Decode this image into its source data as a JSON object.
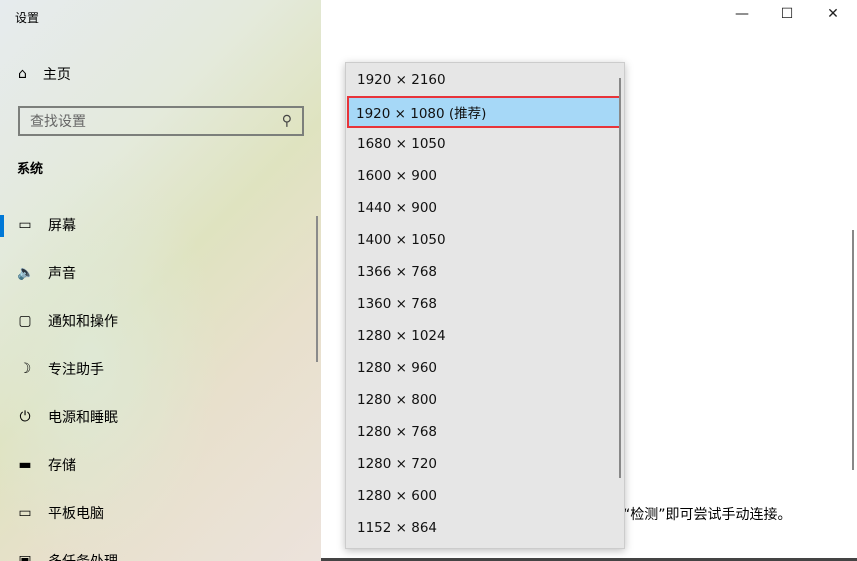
{
  "window": {
    "title": "设置",
    "minimize": "—",
    "maximize": "☐",
    "close": "✕"
  },
  "sidebar": {
    "home_label": "主页",
    "search_placeholder": "查找设置",
    "section": "系统",
    "items": [
      {
        "label": "屏幕",
        "icon": "▭"
      },
      {
        "label": "声音",
        "icon": "🔈"
      },
      {
        "label": "通知和操作",
        "icon": "▢"
      },
      {
        "label": "专注助手",
        "icon": "☽"
      },
      {
        "label": "电源和睡眠",
        "icon": "⏻"
      },
      {
        "label": "存储",
        "icon": "▬"
      },
      {
        "label": "平板电脑",
        "icon": "▭"
      },
      {
        "label": "多任务处理",
        "icon": "▣"
      }
    ]
  },
  "main": {
    "text": "“检测”即可尝试手动连接。"
  },
  "dropdown": {
    "selected_index": 1,
    "options": [
      "1920 × 2160",
      "1920 × 1080 (推荐)",
      "1680 × 1050",
      "1600 × 900",
      "1440 × 900",
      "1400 × 1050",
      "1366 × 768",
      "1360 × 768",
      "1280 × 1024",
      "1280 × 960",
      "1280 × 800",
      "1280 × 768",
      "1280 × 720",
      "1280 × 600",
      "1152 × 864"
    ]
  }
}
